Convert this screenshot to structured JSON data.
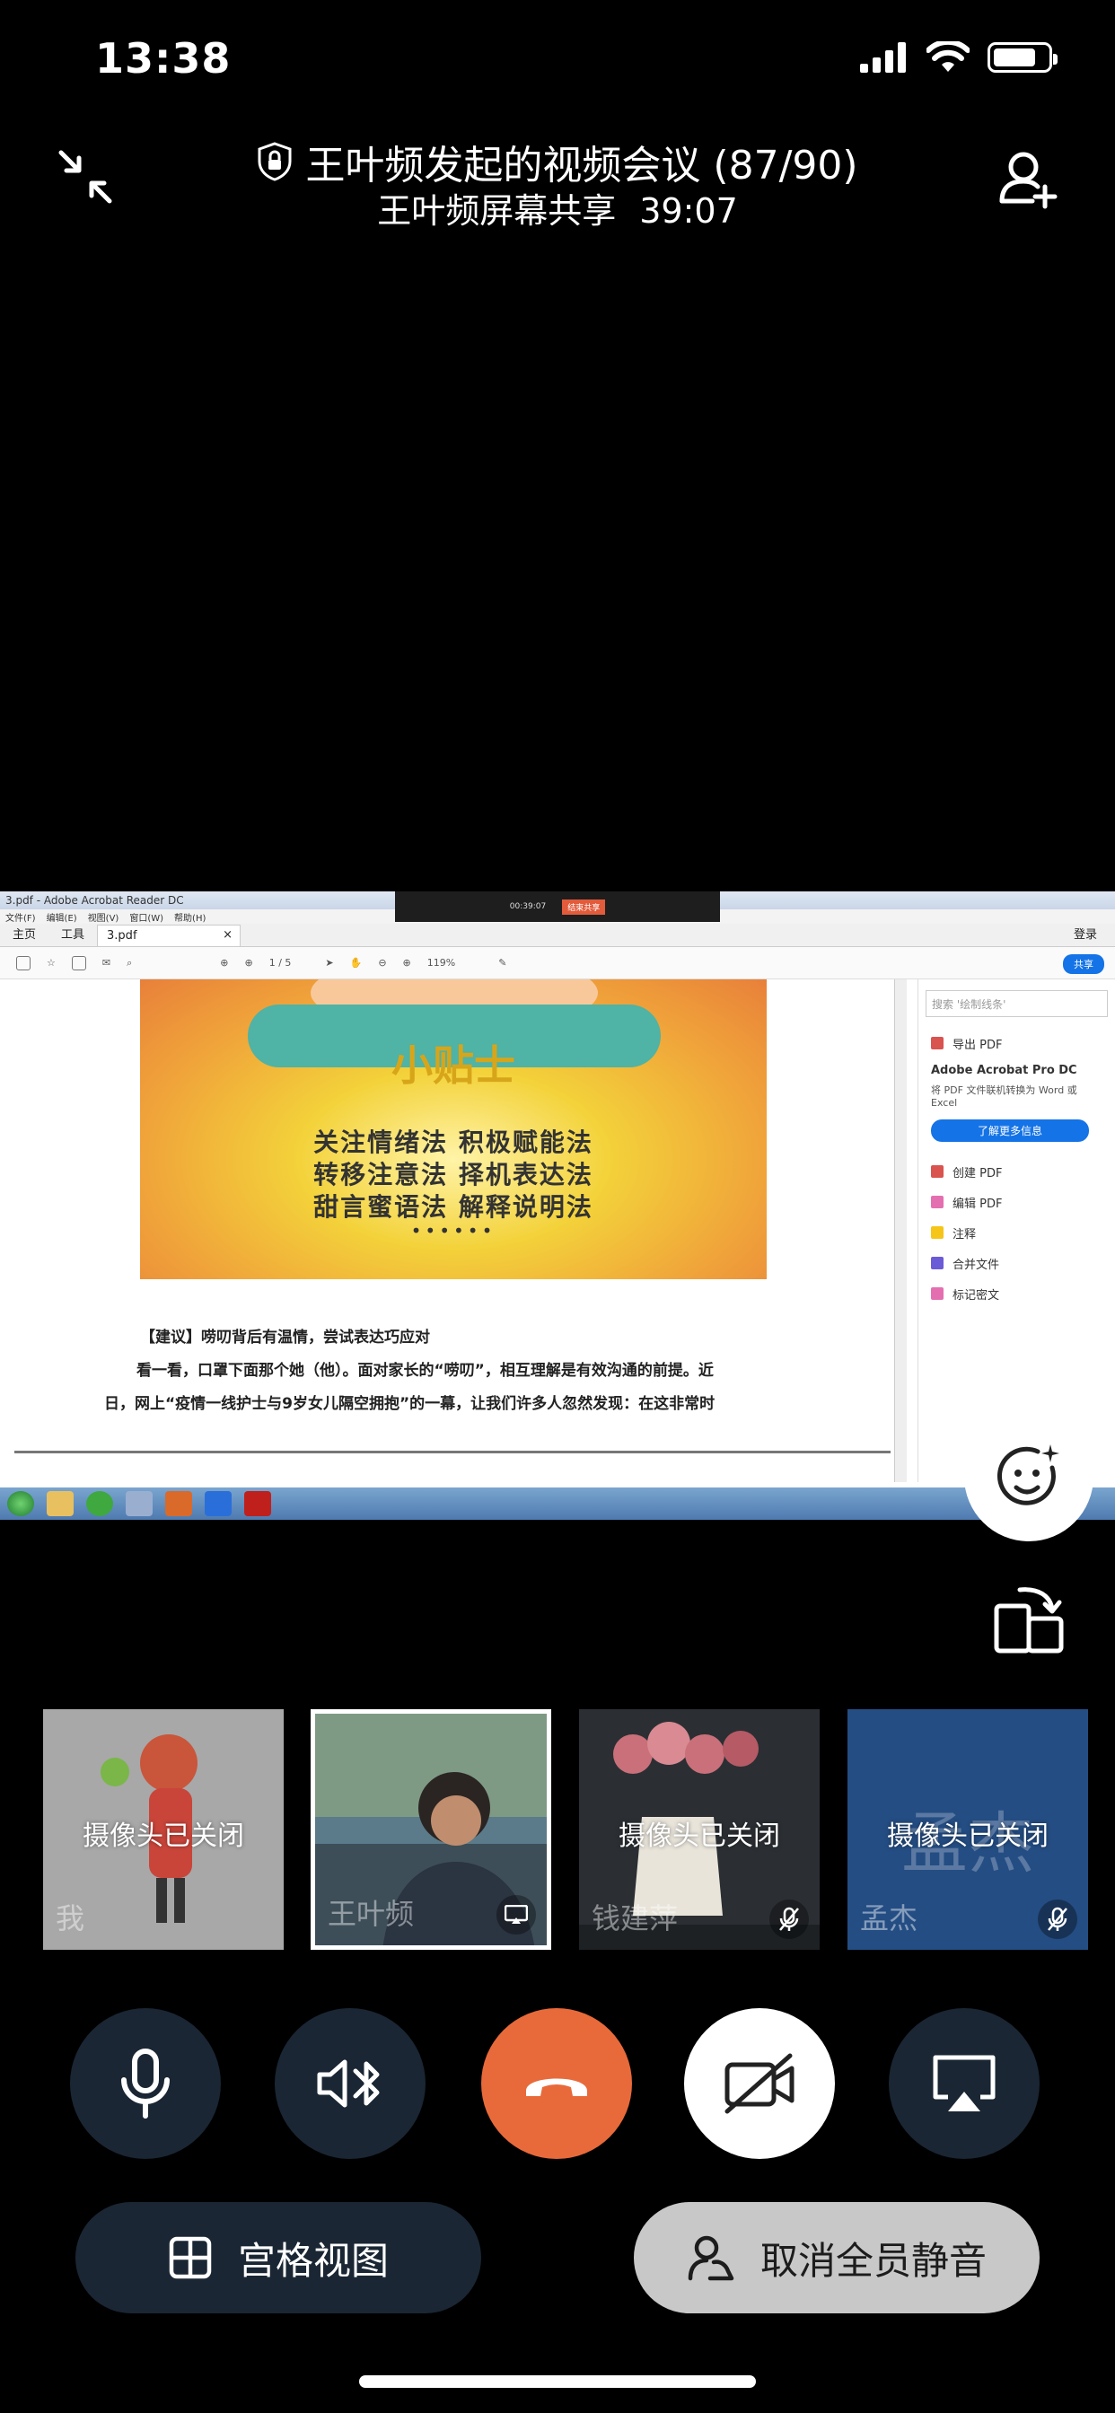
{
  "status_bar": {
    "time": "13:38"
  },
  "header": {
    "title": "王叶频发起的视频会议 (87/90)",
    "subtitle_label": "王叶频屏幕共享",
    "duration": "39:07"
  },
  "shared_screen": {
    "app_title": "3.pdf - Adobe Acrobat Reader DC",
    "menu": [
      "文件(F)",
      "编辑(E)",
      "视图(V)",
      "窗口(W)",
      "帮助(H)"
    ],
    "tabs": {
      "home": "主页",
      "tools": "工具",
      "doc": "3.pdf",
      "login": "登录"
    },
    "page_indicator": "1 / 5",
    "zoom": "119%",
    "share_label": "共享",
    "remote_timer": "00:39:07",
    "remote_end": "结束共享",
    "poster": {
      "title": "小贴士",
      "lines": [
        "关注情绪法  积极赋能法",
        "转移注意法  择机表达法",
        "甜言蜜语法  解释说明法"
      ],
      "dots": "••••••"
    },
    "doc_text": [
      "【建议】唠叨背后有温情，尝试表达巧应对",
      "看一看，口罩下面那个她（他）。面对家长的“唠叨”，相互理解是有效沟通的前提。近",
      "日，网上“疫情一线护士与9岁女儿隔空拥抱”的一幕，让我们许多人忽然发现：在这非常时"
    ],
    "right_panel": {
      "search_placeholder": "搜索 '绘制线条'",
      "export_pdf": "导出 PDF",
      "promo_title": "Adobe Acrobat Pro DC",
      "promo_desc": "将 PDF 文件联机转换为 Word 或 Excel",
      "promo_button": "了解更多信息",
      "items": [
        "创建 PDF",
        "编辑 PDF",
        "注释",
        "合并文件",
        "标记密文"
      ]
    }
  },
  "participants": [
    {
      "name": "我",
      "status": "摄像头已关闭"
    },
    {
      "name": "王叶频",
      "status": ""
    },
    {
      "name": "钱建萍",
      "status": "摄像头已关闭"
    },
    {
      "name": "孟杰",
      "status": "摄像头已关闭",
      "big_name": "孟杰"
    }
  ],
  "controls": {
    "grid_view": "宫格视图",
    "unmute_all": "取消全员静音"
  },
  "colors": {
    "end_call": "#e86a3a",
    "control_bg": "#1a2633",
    "tile_meng": "#244d83",
    "acrobat_blue": "#1473e6"
  }
}
